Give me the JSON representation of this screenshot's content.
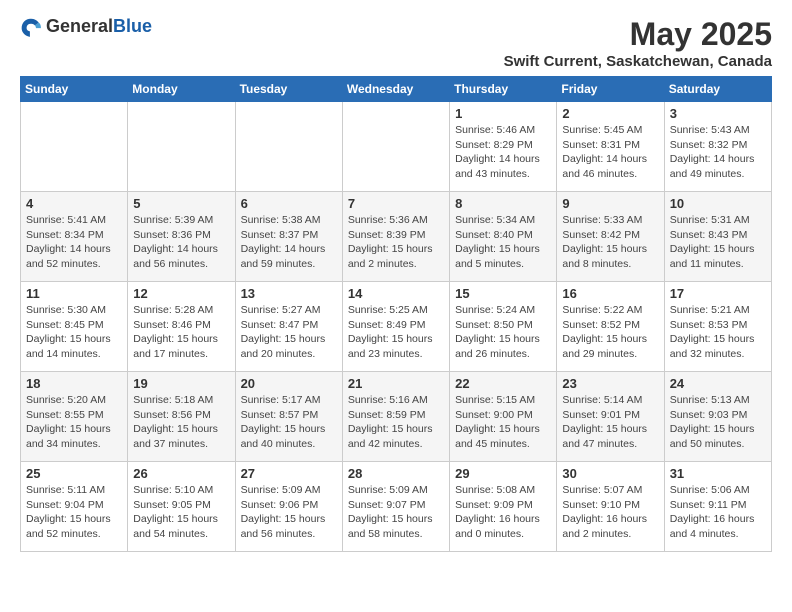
{
  "header": {
    "logo_general": "General",
    "logo_blue": "Blue",
    "month": "May 2025",
    "location": "Swift Current, Saskatchewan, Canada"
  },
  "days_of_week": [
    "Sunday",
    "Monday",
    "Tuesday",
    "Wednesday",
    "Thursday",
    "Friday",
    "Saturday"
  ],
  "weeks": [
    [
      {
        "day": "",
        "info": ""
      },
      {
        "day": "",
        "info": ""
      },
      {
        "day": "",
        "info": ""
      },
      {
        "day": "",
        "info": ""
      },
      {
        "day": "1",
        "info": "Sunrise: 5:46 AM\nSunset: 8:29 PM\nDaylight: 14 hours\nand 43 minutes."
      },
      {
        "day": "2",
        "info": "Sunrise: 5:45 AM\nSunset: 8:31 PM\nDaylight: 14 hours\nand 46 minutes."
      },
      {
        "day": "3",
        "info": "Sunrise: 5:43 AM\nSunset: 8:32 PM\nDaylight: 14 hours\nand 49 minutes."
      }
    ],
    [
      {
        "day": "4",
        "info": "Sunrise: 5:41 AM\nSunset: 8:34 PM\nDaylight: 14 hours\nand 52 minutes."
      },
      {
        "day": "5",
        "info": "Sunrise: 5:39 AM\nSunset: 8:36 PM\nDaylight: 14 hours\nand 56 minutes."
      },
      {
        "day": "6",
        "info": "Sunrise: 5:38 AM\nSunset: 8:37 PM\nDaylight: 14 hours\nand 59 minutes."
      },
      {
        "day": "7",
        "info": "Sunrise: 5:36 AM\nSunset: 8:39 PM\nDaylight: 15 hours\nand 2 minutes."
      },
      {
        "day": "8",
        "info": "Sunrise: 5:34 AM\nSunset: 8:40 PM\nDaylight: 15 hours\nand 5 minutes."
      },
      {
        "day": "9",
        "info": "Sunrise: 5:33 AM\nSunset: 8:42 PM\nDaylight: 15 hours\nand 8 minutes."
      },
      {
        "day": "10",
        "info": "Sunrise: 5:31 AM\nSunset: 8:43 PM\nDaylight: 15 hours\nand 11 minutes."
      }
    ],
    [
      {
        "day": "11",
        "info": "Sunrise: 5:30 AM\nSunset: 8:45 PM\nDaylight: 15 hours\nand 14 minutes."
      },
      {
        "day": "12",
        "info": "Sunrise: 5:28 AM\nSunset: 8:46 PM\nDaylight: 15 hours\nand 17 minutes."
      },
      {
        "day": "13",
        "info": "Sunrise: 5:27 AM\nSunset: 8:47 PM\nDaylight: 15 hours\nand 20 minutes."
      },
      {
        "day": "14",
        "info": "Sunrise: 5:25 AM\nSunset: 8:49 PM\nDaylight: 15 hours\nand 23 minutes."
      },
      {
        "day": "15",
        "info": "Sunrise: 5:24 AM\nSunset: 8:50 PM\nDaylight: 15 hours\nand 26 minutes."
      },
      {
        "day": "16",
        "info": "Sunrise: 5:22 AM\nSunset: 8:52 PM\nDaylight: 15 hours\nand 29 minutes."
      },
      {
        "day": "17",
        "info": "Sunrise: 5:21 AM\nSunset: 8:53 PM\nDaylight: 15 hours\nand 32 minutes."
      }
    ],
    [
      {
        "day": "18",
        "info": "Sunrise: 5:20 AM\nSunset: 8:55 PM\nDaylight: 15 hours\nand 34 minutes."
      },
      {
        "day": "19",
        "info": "Sunrise: 5:18 AM\nSunset: 8:56 PM\nDaylight: 15 hours\nand 37 minutes."
      },
      {
        "day": "20",
        "info": "Sunrise: 5:17 AM\nSunset: 8:57 PM\nDaylight: 15 hours\nand 40 minutes."
      },
      {
        "day": "21",
        "info": "Sunrise: 5:16 AM\nSunset: 8:59 PM\nDaylight: 15 hours\nand 42 minutes."
      },
      {
        "day": "22",
        "info": "Sunrise: 5:15 AM\nSunset: 9:00 PM\nDaylight: 15 hours\nand 45 minutes."
      },
      {
        "day": "23",
        "info": "Sunrise: 5:14 AM\nSunset: 9:01 PM\nDaylight: 15 hours\nand 47 minutes."
      },
      {
        "day": "24",
        "info": "Sunrise: 5:13 AM\nSunset: 9:03 PM\nDaylight: 15 hours\nand 50 minutes."
      }
    ],
    [
      {
        "day": "25",
        "info": "Sunrise: 5:11 AM\nSunset: 9:04 PM\nDaylight: 15 hours\nand 52 minutes."
      },
      {
        "day": "26",
        "info": "Sunrise: 5:10 AM\nSunset: 9:05 PM\nDaylight: 15 hours\nand 54 minutes."
      },
      {
        "day": "27",
        "info": "Sunrise: 5:09 AM\nSunset: 9:06 PM\nDaylight: 15 hours\nand 56 minutes."
      },
      {
        "day": "28",
        "info": "Sunrise: 5:09 AM\nSunset: 9:07 PM\nDaylight: 15 hours\nand 58 minutes."
      },
      {
        "day": "29",
        "info": "Sunrise: 5:08 AM\nSunset: 9:09 PM\nDaylight: 16 hours\nand 0 minutes."
      },
      {
        "day": "30",
        "info": "Sunrise: 5:07 AM\nSunset: 9:10 PM\nDaylight: 16 hours\nand 2 minutes."
      },
      {
        "day": "31",
        "info": "Sunrise: 5:06 AM\nSunset: 9:11 PM\nDaylight: 16 hours\nand 4 minutes."
      }
    ]
  ]
}
